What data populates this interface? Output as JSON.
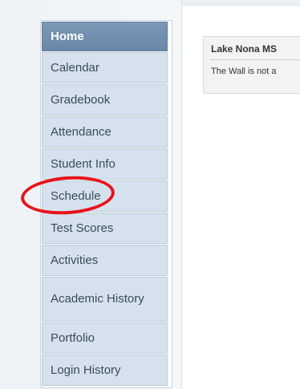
{
  "nav": {
    "items": [
      {
        "label": "Home"
      },
      {
        "label": "Calendar"
      },
      {
        "label": "Gradebook"
      },
      {
        "label": "Attendance"
      },
      {
        "label": "Student Info"
      },
      {
        "label": "Schedule"
      },
      {
        "label": "Test Scores"
      },
      {
        "label": "Activities"
      },
      {
        "label": "Academic History"
      },
      {
        "label": "Portfolio"
      },
      {
        "label": "Login History"
      }
    ],
    "active": "Home"
  },
  "card": {
    "title": "Lake Nona MS",
    "text": "The Wall is not a"
  },
  "colors": {
    "active_bg": "#6f8dad",
    "item_bg": "#d5e2ee",
    "annotation": "#e8131b"
  }
}
